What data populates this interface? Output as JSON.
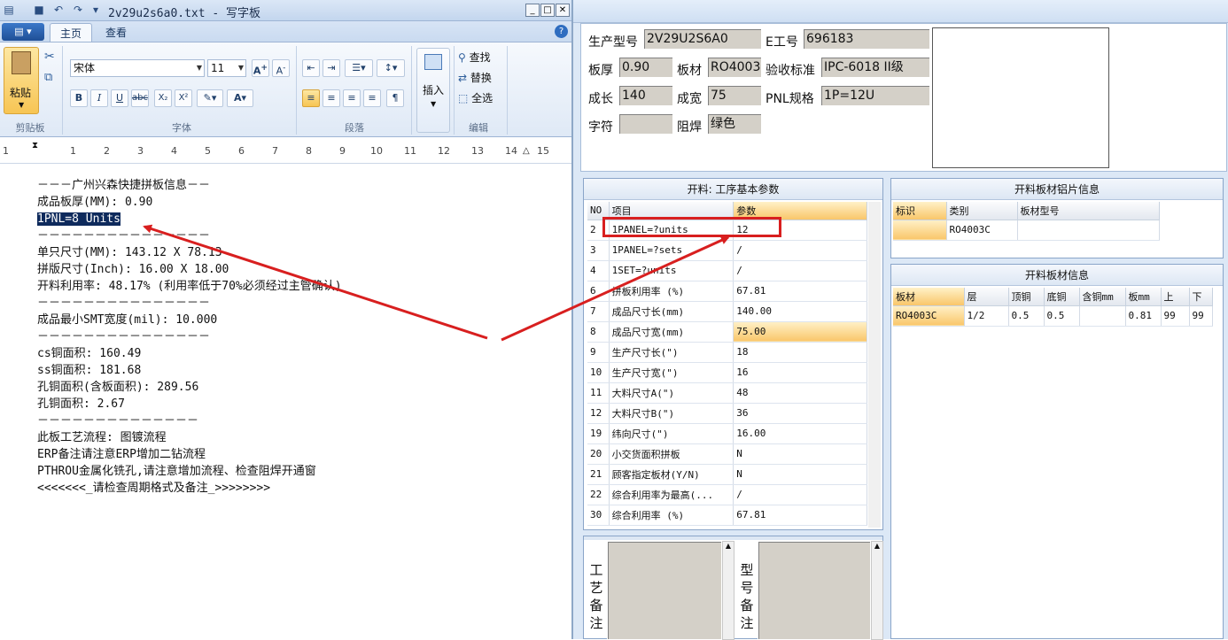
{
  "wordpad": {
    "title": "2v29u2s6a0.txt - 写字板",
    "app_menu": "▤ ▾",
    "tabs": [
      "主页",
      "查看"
    ],
    "font_name": "宋体",
    "font_size": "11",
    "groups": {
      "clipboard": "剪贴板",
      "font": "字体",
      "paragraph": "段落",
      "edit": "编辑"
    },
    "paste_label": "粘贴",
    "insert_label": "插入",
    "find_label": "查找",
    "replace_label": "替换",
    "select_all_label": "全选",
    "ruler_numbers": [
      "1",
      "1",
      "2",
      "3",
      "4",
      "5",
      "6",
      "7",
      "8",
      "9",
      "10",
      "11",
      "12",
      "13",
      "14",
      "15"
    ],
    "lines": [
      "－－－广州兴森快捷拼板信息－－",
      "成品板厚(MM): 0.90",
      "1PNL=8 Units",
      "－－－－－－－－－－－－－－－",
      "单只尺寸(MM): 143.12 X 78.13",
      "拼版尺寸(Inch): 16.00 X 18.00",
      "开料利用率: 48.17% (利用率低于70%必须经过主管确认)",
      "－－－－－－－－－－－－－－－",
      "成品最小SMT宽度(mil): 10.000",
      "－－－－－－－－－－－－－－－",
      "cs铜面积: 160.49",
      "ss铜面积: 181.68",
      "孔铜面积(含板面积): 289.56",
      "孔铜面积: 2.67",
      "－－－－－－－－－－－－－－",
      "此板工艺流程: 图镀流程",
      "ERP备注请注意ERP增加二钻流程",
      "PTHROU金属化铣孔,请注意增加流程、检查阻焊开通窗",
      "<<<<<<<_请检查周期格式及备注_>>>>>>>>"
    ]
  },
  "app": {
    "fields": {
      "model_label": "生产型号",
      "model": "2V29U2S6A0",
      "eno_label": "E工号",
      "eno": "696183",
      "thick_label": "板厚",
      "thick": "0.90",
      "material_label": "板材",
      "material": "RO4003C",
      "std_label": "验收标准",
      "std": "IPC-6018 II级",
      "len_label": "成长",
      "len": "140",
      "wid_label": "成宽",
      "wid": "75",
      "pnl_label": "PNL规格",
      "pnl": "1P=12U",
      "char_label": "字符",
      "char": "",
      "mask_label": "阻焊",
      "mask": "绿色"
    },
    "params_title": "开料: 工序基本参数",
    "params_headers": [
      "NO",
      "项目",
      "参数"
    ],
    "params_rows": [
      [
        "2",
        "1PANEL=?units",
        "12"
      ],
      [
        "3",
        "1PANEL=?sets",
        "/"
      ],
      [
        "4",
        "1SET=?units",
        "/"
      ],
      [
        "6",
        "拼板利用率 (%)",
        "67.81"
      ],
      [
        "7",
        "成品尺寸长(mm)",
        "140.00"
      ],
      [
        "8",
        "成品尺寸宽(mm)",
        "75.00"
      ],
      [
        "9",
        "生产尺寸长(\")",
        "18"
      ],
      [
        "10",
        "生产尺寸宽(\")",
        "16"
      ],
      [
        "11",
        "大料尺寸A(\")",
        "48"
      ],
      [
        "12",
        "大料尺寸B(\")",
        "36"
      ],
      [
        "19",
        "纬向尺寸(\")",
        "16.00"
      ],
      [
        "20",
        "小交货面积拼板",
        "N"
      ],
      [
        "21",
        "顾客指定板材(Y/N)",
        "N"
      ],
      [
        "22",
        "综合利用率为最高(...",
        "/"
      ],
      [
        "30",
        "综合利用率 (%)",
        "67.81"
      ]
    ],
    "foil_title": "开料板材铝片信息",
    "foil_headers": [
      "标识",
      "类别",
      "板材型号"
    ],
    "foil_row": [
      "",
      "RO4003C",
      ""
    ],
    "sheet_title": "开料板材信息",
    "sheet_headers": [
      "板材",
      "层",
      "顶铜",
      "底铜",
      "含铜mm",
      "板mm",
      "上",
      "下"
    ],
    "sheet_row": [
      "RO4003C",
      "1/2",
      "0.5",
      "0.5",
      "",
      "0.81",
      "99",
      "99"
    ],
    "process_note_label": [
      "工",
      "艺",
      "备",
      "注"
    ],
    "model_note_label": [
      "型",
      "号",
      "备",
      "注"
    ]
  },
  "colors": {
    "arrow": "#d81f1f",
    "selection": "#0e2a5c",
    "highlight": "#f9c66a"
  }
}
